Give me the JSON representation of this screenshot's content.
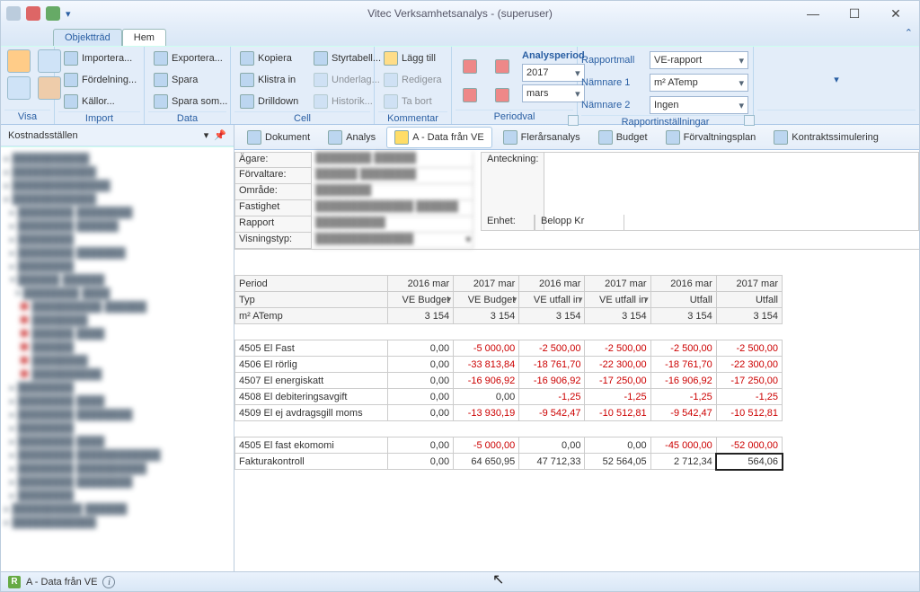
{
  "title": "Vitec Verksamhetsanalys - (superuser)",
  "docTabs": {
    "objekttrad": "Objektträd",
    "hem": "Hem"
  },
  "ribbon": {
    "visa": "Visa",
    "import": "Import",
    "importera": "Importera...",
    "fordelning": "Fördelning...",
    "kallor": "Källor...",
    "data": "Data",
    "exportera": "Exportera...",
    "spara": "Spara",
    "sparasom": "Spara som...",
    "cell": "Cell",
    "kopiera": "Kopiera",
    "klistrain": "Klistra in",
    "drilldown": "Drilldown",
    "styrtabell": "Styrtabell...",
    "underlag": "Underlag...",
    "historik": "Historik...",
    "kommentar": "Kommentar",
    "laggtill": "Lägg till",
    "redigera": "Redigera",
    "tabort": "Ta bort",
    "periodval": "Periodval",
    "analysperiod": "Analysperiod",
    "year": "2017",
    "month": "mars",
    "rapportinst": "Rapportinställningar",
    "rapportmall_k": "Rapportmall",
    "rapportmall_v": "VE-rapport",
    "namnare1_k": "Nämnare 1",
    "namnare1_v": "m² ATemp",
    "namnare2_k": "Nämnare 2",
    "namnare2_v": "Ingen"
  },
  "side": {
    "title": "Kostnadsställen"
  },
  "subtabs": {
    "dokument": "Dokument",
    "analys": "Analys",
    "adata": "A - Data från VE",
    "flerars": "Flerårsanalys",
    "budget": "Budget",
    "forvalt": "Förvaltningsplan",
    "kontrakt": "Kontraktssimulering"
  },
  "props": {
    "agare": "Ägare:",
    "forvaltare": "Förvaltare:",
    "omrade": "Område:",
    "fastighet": "Fastighet",
    "rapport": "Rapport",
    "visningstyp": "Visningstyp:",
    "anteckning": "Anteckning:",
    "enhet": "Enhet:",
    "enhet_v": "Belopp Kr"
  },
  "table": {
    "headers": {
      "period": "Period",
      "typ": "Typ",
      "matemp": "m² ATemp",
      "cols": [
        "2016 mar",
        "2017 mar",
        "2016 mar",
        "2017 mar",
        "2016 mar",
        "2017 mar"
      ],
      "typrow": [
        "VE Budget",
        "VE Budget",
        "VE utfall in",
        "VE utfall in",
        "Utfall",
        "Utfall"
      ],
      "ma": [
        "3 154",
        "3 154",
        "3 154",
        "3 154",
        "3 154",
        "3 154"
      ]
    },
    "rows": [
      {
        "label": "4505 El Fast",
        "v": [
          "0,00",
          "-5 000,00",
          "-2 500,00",
          "-2 500,00",
          "-2 500,00",
          "-2 500,00"
        ]
      },
      {
        "label": "4506 El rörlig",
        "v": [
          "0,00",
          "-33 813,84",
          "-18 761,70",
          "-22 300,00",
          "-18 761,70",
          "-22 300,00"
        ]
      },
      {
        "label": "4507 El energiskatt",
        "v": [
          "0,00",
          "-16 906,92",
          "-16 906,92",
          "-17 250,00",
          "-16 906,92",
          "-17 250,00"
        ]
      },
      {
        "label": "4508 El debiteringsavgift",
        "v": [
          "0,00",
          "0,00",
          "-1,25",
          "-1,25",
          "-1,25",
          "-1,25"
        ]
      },
      {
        "label": "4509 El ej avdragsgill moms",
        "v": [
          "0,00",
          "-13 930,19",
          "-9 542,47",
          "-10 512,81",
          "-9 542,47",
          "-10 512,81"
        ]
      }
    ],
    "sumrows": [
      {
        "label": "4505 El fast ekomomi",
        "v": [
          "0,00",
          "-5 000,00",
          "0,00",
          "0,00",
          "-45 000,00",
          "-52 000,00"
        ]
      },
      {
        "label": "Fakturakontroll",
        "v": [
          "0,00",
          "64 650,95",
          "47 712,33",
          "52 564,05",
          "2 712,34",
          "564,06"
        ]
      }
    ]
  },
  "status": {
    "text": "A - Data från VE"
  }
}
